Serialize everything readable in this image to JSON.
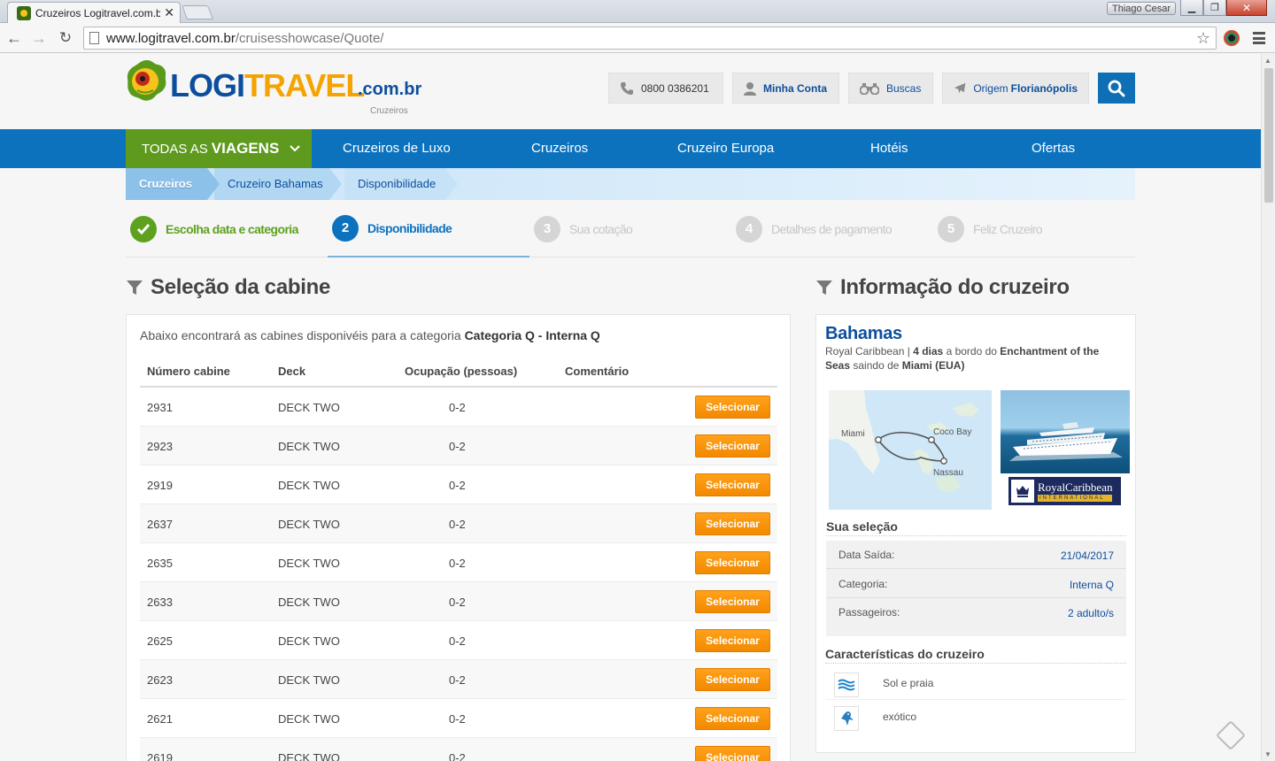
{
  "browser": {
    "tab_title": "Cruzeiros Logitravel.com.b",
    "user_name": "Thiago Cesar",
    "url_host": "www.logitravel.com.br",
    "url_path": "/cruisesshowcase/Quote/"
  },
  "header": {
    "logo_logi": "LOGI",
    "logo_travel": "TRAVEL",
    "logo_domain": ".com.br",
    "logo_sub": "Cruzeiros",
    "phone": "0800 0386201",
    "account": "Minha Conta",
    "searches": "Buscas",
    "origin_label": "Origem",
    "origin_city": "Florianópolis"
  },
  "nav": {
    "all_prefix": "TODAS AS",
    "all_strong": "VIAGENS",
    "links": [
      "Cruzeiros de Luxo",
      "Cruzeiros",
      "Cruzeiro Europa",
      "Hotéis",
      "Ofertas"
    ]
  },
  "breadcrumb": [
    "Cruzeiros",
    "Cruzeiro Bahamas",
    "Disponibilidade"
  ],
  "steps": [
    {
      "num": "✓",
      "label": "Escolha data e categoria",
      "state": "done"
    },
    {
      "num": "2",
      "label": "Disponibilidade",
      "state": "active"
    },
    {
      "num": "3",
      "label": "Sua cotação",
      "state": "todo"
    },
    {
      "num": "4",
      "label": "Detalhes de pagamento",
      "state": "todo"
    },
    {
      "num": "5",
      "label": "Feliz Cruzeiro",
      "state": "todo"
    }
  ],
  "cabins": {
    "title": "Seleção da cabine",
    "intro_text": "Abaixo encontrará as cabines disponivéis para a categoria",
    "intro_category": "Categoria Q - Interna Q",
    "columns": [
      "Número cabine",
      "Deck",
      "Ocupação (pessoas)",
      "Comentário"
    ],
    "button_label": "Selecionar",
    "rows": [
      {
        "number": "2931",
        "deck": "DECK TWO",
        "occupancy": "0-2"
      },
      {
        "number": "2923",
        "deck": "DECK TWO",
        "occupancy": "0-2"
      },
      {
        "number": "2919",
        "deck": "DECK TWO",
        "occupancy": "0-2"
      },
      {
        "number": "2637",
        "deck": "DECK TWO",
        "occupancy": "0-2"
      },
      {
        "number": "2635",
        "deck": "DECK TWO",
        "occupancy": "0-2"
      },
      {
        "number": "2633",
        "deck": "DECK TWO",
        "occupancy": "0-2"
      },
      {
        "number": "2625",
        "deck": "DECK TWO",
        "occupancy": "0-2"
      },
      {
        "number": "2623",
        "deck": "DECK TWO",
        "occupancy": "0-2"
      },
      {
        "number": "2621",
        "deck": "DECK TWO",
        "occupancy": "0-2"
      },
      {
        "number": "2619",
        "deck": "DECK TWO",
        "occupancy": "0-2"
      }
    ]
  },
  "cruise": {
    "title": "Informação do cruzeiro",
    "destination": "Bahamas",
    "line": "Royal Caribbean",
    "duration": "4 dias",
    "aboard": "a bordo do",
    "ship": "Enchantment of the Seas",
    "leaving": "saindo de",
    "port": "Miami (EUA)",
    "map_labels": {
      "miami": "Miami",
      "cocobay": "Coco Bay",
      "nassau": "Nassau"
    },
    "brand_name": "RoyalCaribbean",
    "brand_sub": "INTERNATIONAL",
    "selection_title": "Sua seleção",
    "selection": [
      {
        "label": "Data Saída:",
        "value": "21/04/2017"
      },
      {
        "label": "Categoria:",
        "value": "Interna Q"
      },
      {
        "label": "Passageiros:",
        "value": "2 adulto/s"
      }
    ],
    "features_title": "Características do cruzeiro",
    "features": [
      {
        "icon": "waves-icon",
        "label": "Sol e praia"
      },
      {
        "icon": "parrot-icon",
        "label": "exótico"
      }
    ]
  },
  "colors": {
    "brand_blue": "#0d72be",
    "brand_green": "#5e9a1e",
    "button_orange": "#f28a00",
    "logo_yellow": "#f5a300"
  }
}
